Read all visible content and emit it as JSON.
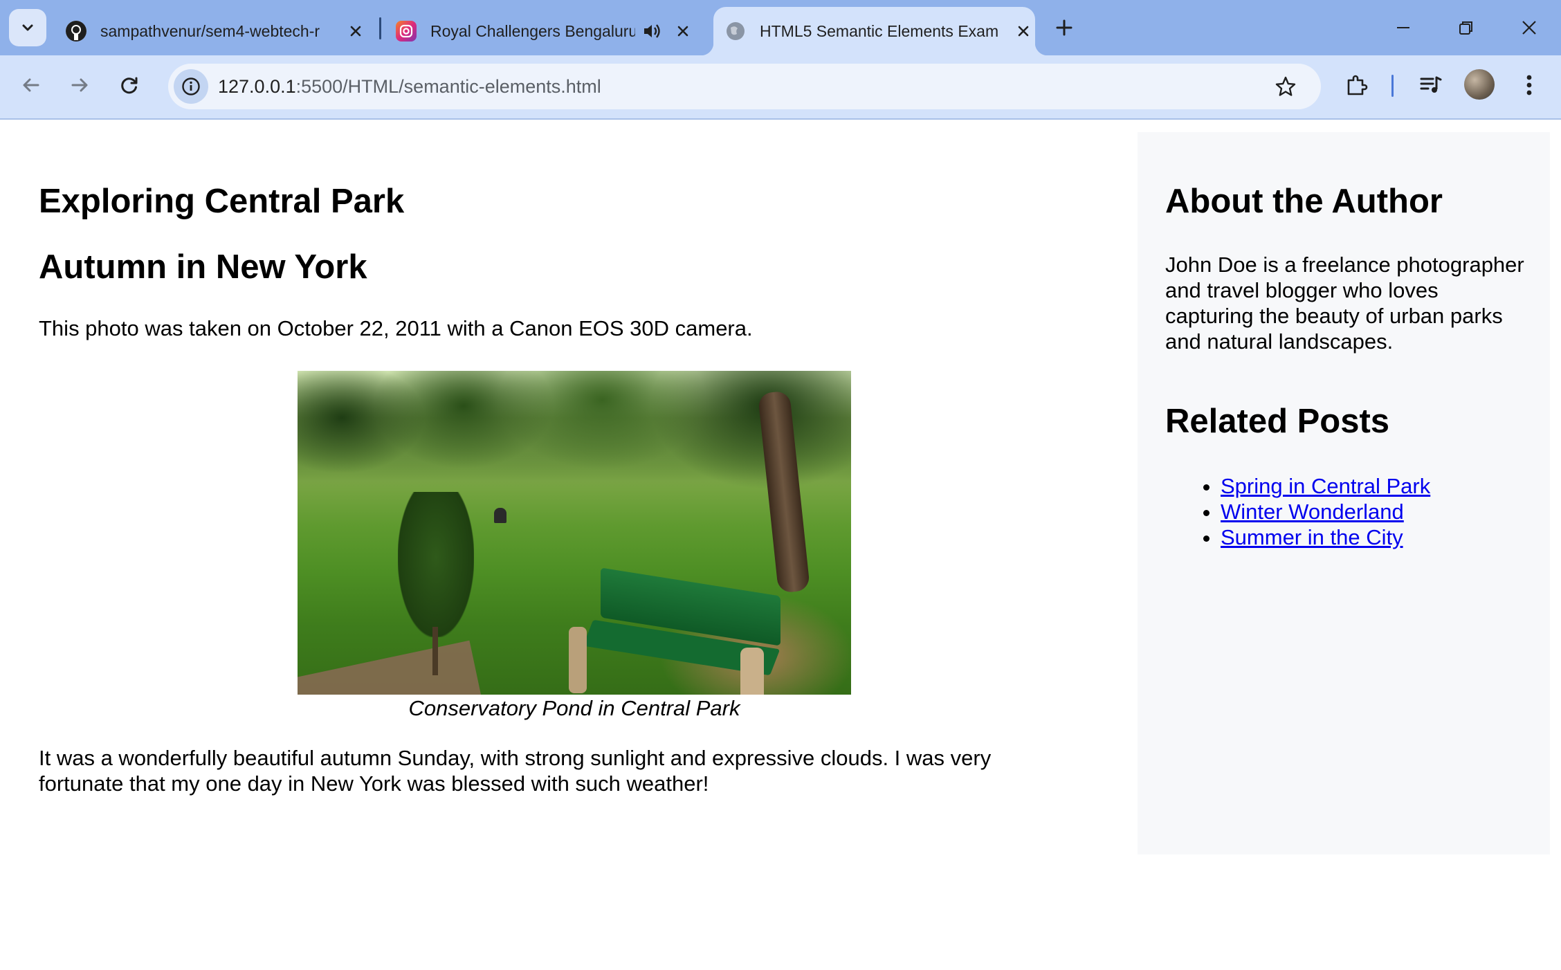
{
  "browser": {
    "tabs": [
      {
        "title": "sampathvenur/sem4-webtech-r",
        "favicon": "github-icon",
        "active": false
      },
      {
        "title": "Royal Challengers Bengaluru",
        "favicon": "instagram-icon",
        "audio": "speaker-icon",
        "active": false
      },
      {
        "title": "HTML5 Semantic Elements Exam",
        "favicon": "globe-icon",
        "active": true
      }
    ],
    "address": {
      "host": "127.0.0.1",
      "path": ":5500/HTML/semantic-elements.html"
    },
    "colors": {
      "tabstrip": "#8fb1ea",
      "toolbar": "#d3e2fb"
    }
  },
  "page": {
    "main": {
      "title": "Exploring Central Park",
      "subtitle": "Autumn in New York",
      "intro": "This photo was taken on October 22, 2011 with a Canon EOS 30D camera.",
      "caption": "Conservatory Pond in Central Park",
      "body": "It was a wonderfully beautiful autumn Sunday, with strong sunlight and expressive clouds. I was very fortunate that my one day in New York was blessed with such weather!"
    },
    "aside": {
      "about_heading": "About the Author",
      "about_text": "John Doe is a freelance photographer and travel blogger who loves capturing the beauty of urban parks and natural landscapes.",
      "related_heading": "Related Posts",
      "related": [
        {
          "label": "Spring in Central Park"
        },
        {
          "label": "Winter Wonderland"
        },
        {
          "label": "Summer in the City"
        }
      ]
    }
  }
}
